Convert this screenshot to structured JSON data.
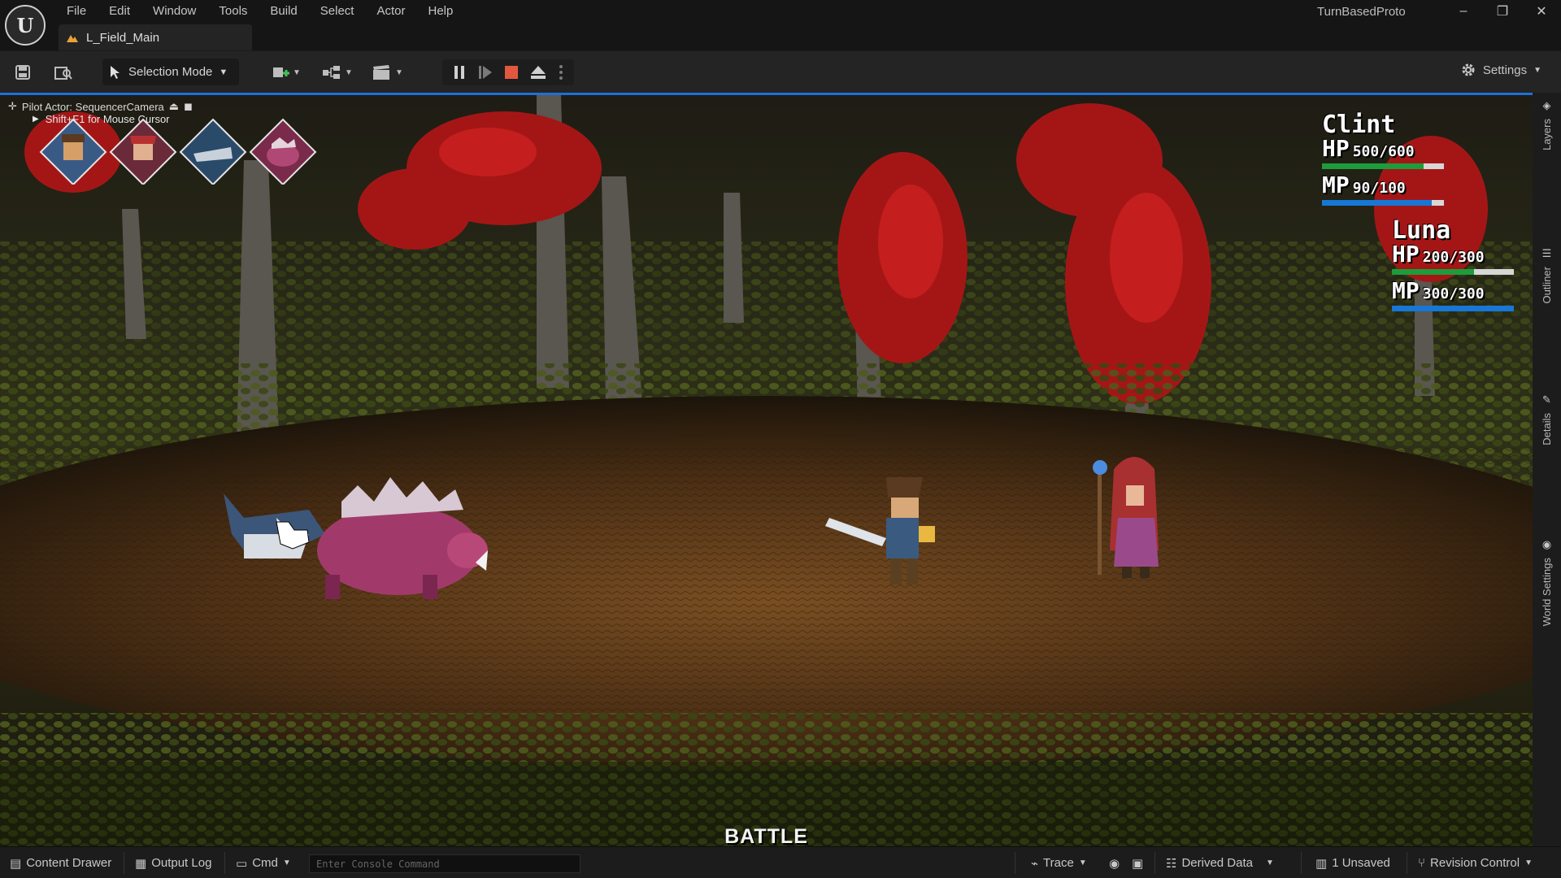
{
  "app": {
    "logo_glyph": "U",
    "menu": [
      "File",
      "Edit",
      "Window",
      "Tools",
      "Build",
      "Select",
      "Actor",
      "Help"
    ],
    "project_name": "TurnBasedProto",
    "level_tab": "L_Field_Main",
    "window_controls": {
      "minimize": "–",
      "restore": "❐",
      "close": "✕"
    }
  },
  "toolbar": {
    "mode_label": "Selection Mode",
    "settings_label": "Settings",
    "icons": [
      "save-icon",
      "content-browser-icon",
      "add-actor-icon",
      "blueprint-icon",
      "cinematics-icon",
      "pause-icon",
      "step-icon",
      "stop-icon",
      "eject-icon",
      "more-icon",
      "settings-icon"
    ]
  },
  "viewport": {
    "pilot_label": "Pilot Actor: SequencerCamera",
    "mouse_hint": "Shift+F1 for Mouse Cursor",
    "turn_order": [
      "hero-portrait",
      "mage-portrait",
      "wolf-portrait",
      "boar-portrait"
    ],
    "battle_label": "BATTLE"
  },
  "party": [
    {
      "name": "Clint",
      "hp_label": "HP",
      "hp": "500/600",
      "hp_ratio": 0.83,
      "mp_label": "MP",
      "mp": "90/100",
      "mp_ratio": 0.9
    },
    {
      "name": "Luna",
      "hp_label": "HP",
      "hp": "200/300",
      "hp_ratio": 0.67,
      "mp_label": "MP",
      "mp": "300/300",
      "mp_ratio": 1.0
    }
  ],
  "side_panel": [
    "Layers",
    "Outliner",
    "Details",
    "World Settings"
  ],
  "statusbar": {
    "content_drawer": "Content Drawer",
    "output_log": "Output Log",
    "cmd": "Cmd",
    "console_placeholder": "Enter Console Command",
    "trace": "Trace",
    "derived_data": "Derived Data",
    "unsaved": "1 Unsaved",
    "revision_control": "Revision Control"
  },
  "colors": {
    "accent_blue": "#1f6fd8",
    "hp_green": "#1d9c3b",
    "mp_blue": "#1777d6",
    "stop_red": "#e2583e"
  }
}
